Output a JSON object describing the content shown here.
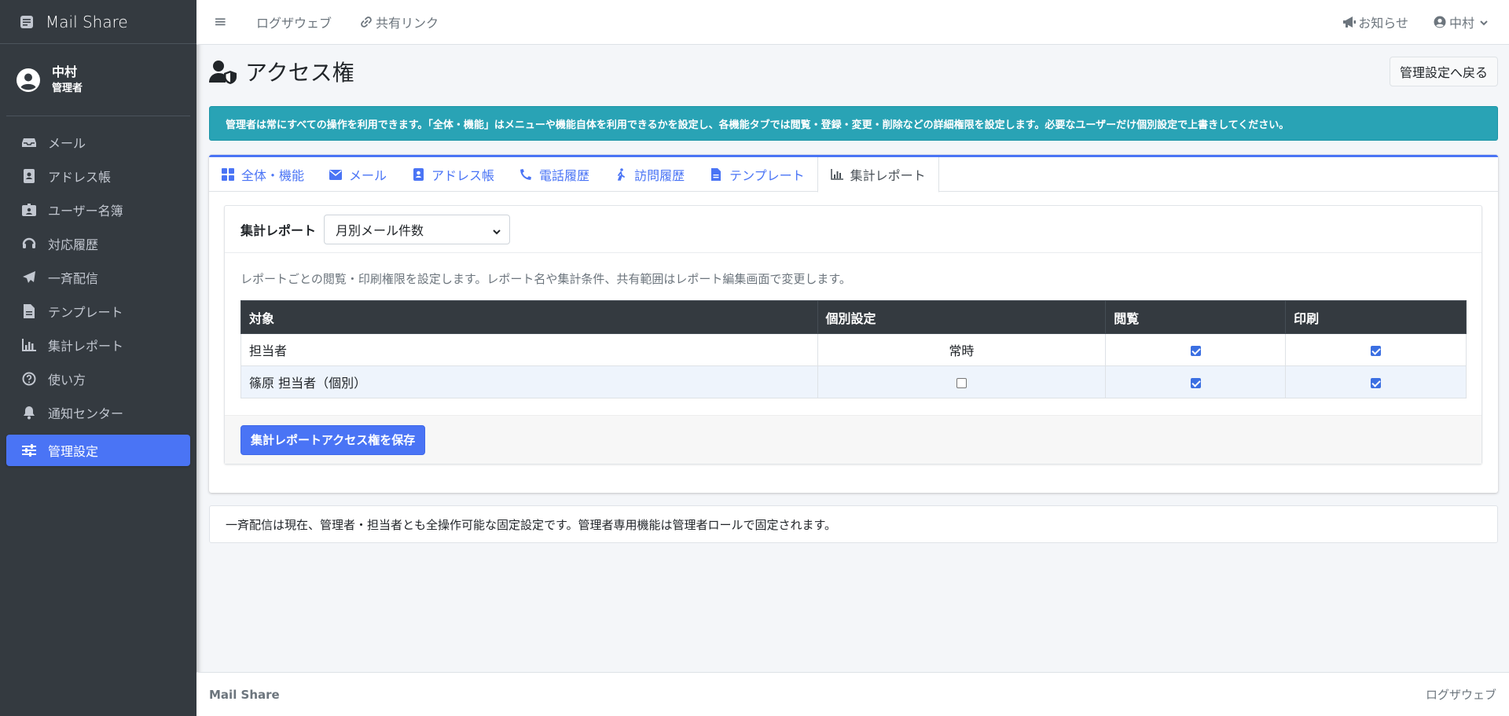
{
  "app": {
    "name": "Mail Share"
  },
  "user": {
    "name": "中村",
    "role": "管理者"
  },
  "sidebar": {
    "items": [
      {
        "label": "メール",
        "icon": "inbox-icon"
      },
      {
        "label": "アドレス帳",
        "icon": "address-book-icon"
      },
      {
        "label": "ユーザー名簿",
        "icon": "id-badge-icon"
      },
      {
        "label": "対応履歴",
        "icon": "headset-icon"
      },
      {
        "label": "一斉配信",
        "icon": "paper-plane-icon"
      },
      {
        "label": "テンプレート",
        "icon": "file-text-icon"
      },
      {
        "label": "集計レポート",
        "icon": "bar-chart-icon"
      },
      {
        "label": "使い方",
        "icon": "question-circle-icon"
      },
      {
        "label": "通知センター",
        "icon": "bell-icon"
      },
      {
        "label": "管理設定",
        "icon": "sliders-icon",
        "active": true
      }
    ]
  },
  "topbar": {
    "menu_icon": "≡",
    "links": [
      "ログザウェブ",
      "共有リンク"
    ],
    "notice": "お知らせ",
    "user": "中村"
  },
  "page": {
    "title": "アクセス権",
    "back_button": "管理設定へ戻る",
    "alert": "管理者は常にすべての操作を利用できます。「全体・機能」はメニューや機能自体を利用できるかを設定し、各機能タブでは閲覧・登録・変更・削除などの詳細権限を設定します。必要なユーザーだけ個別設定で上書きしてください。"
  },
  "tabs": [
    {
      "label": "全体・機能",
      "icon": "grid-icon"
    },
    {
      "label": "メール",
      "icon": "envelope-icon"
    },
    {
      "label": "アドレス帳",
      "icon": "address-book-icon"
    },
    {
      "label": "電話履歴",
      "icon": "phone-icon"
    },
    {
      "label": "訪問履歴",
      "icon": "walking-icon"
    },
    {
      "label": "テンプレート",
      "icon": "file-text-icon"
    },
    {
      "label": "集計レポート",
      "icon": "bar-chart-icon",
      "active": true
    }
  ],
  "report": {
    "label": "集計レポート",
    "selected": "月別メール件数",
    "description": "レポートごとの閲覧・印刷権限を設定します。レポート名や集計条件、共有範囲はレポート編集画面で変更します。",
    "columns": [
      "対象",
      "個別設定",
      "閲覧",
      "印刷"
    ],
    "rows": [
      {
        "target": "担当者",
        "individual": "常時",
        "view": true,
        "print": true
      },
      {
        "target": "篠原 担当者（個別）",
        "individual": false,
        "view": true,
        "print": true
      }
    ],
    "save_button": "集計レポートアクセス権を保存"
  },
  "note": "一斉配信は現在、管理者・担当者とも全操作可能な固定設定です。管理者専用機能は管理者ロールで固定されます。",
  "footer": {
    "left": "Mail Share",
    "right": "ログザウェブ"
  },
  "colors": {
    "accent": "#4a74f5",
    "sidebar": "#343a40",
    "alert": "#29a3b5"
  }
}
